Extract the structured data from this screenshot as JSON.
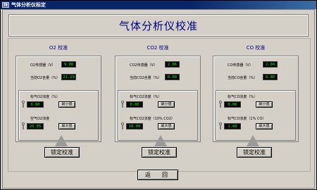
{
  "window": {
    "title": "气体分析仪标定",
    "icon": "app-icon",
    "icon_text": "I$"
  },
  "heading": "气体分析仪校准",
  "columns": [
    {
      "title": "O2 校准",
      "sensor_label": "O2传感器（V）",
      "sensor_value": "9.00",
      "current_label": "当前O2含量（%）",
      "current_value": "21.29",
      "std1_label": "标气O2浓度（%）",
      "std1_value": "0.00",
      "std1_button": "最小值",
      "std2_label": "空气O2浓度",
      "std2_value": "20.95",
      "std2_button": "最大值",
      "lock_button": "锁定校准"
    },
    {
      "title": "CO2 校准",
      "sensor_label": "CO2传感器（V）",
      "sensor_value": "2.06",
      "current_label": "当前CO2含量（%）",
      "current_value": "0.00",
      "std1_label": "标气CO2浓度（%）",
      "std1_value": "0.00",
      "std1_button": "最小值",
      "std2_label": "标气CO2浓度（10% CO2）",
      "std2_value": "10.00",
      "std2_button": "最大值",
      "lock_button": "锁定校准"
    },
    {
      "title": "CO 校准",
      "sensor_label": "CO传感器（V）",
      "sensor_value": "2.04",
      "current_label": "当前CO含量（%）",
      "current_value": "0.00",
      "std1_label": "标气CO浓度（%）",
      "std1_value": "0.00",
      "std1_button": "最小值",
      "std2_label": "标气CO浓度（1% CO）",
      "std2_value": "1.00",
      "std2_button": "最大值",
      "lock_button": "锁定校准"
    }
  ],
  "back_button": "返　回",
  "colors": {
    "display_bg": "#000000",
    "display_text": "#00ff00",
    "heading": "#000080",
    "panel": "#d4d0c8"
  }
}
